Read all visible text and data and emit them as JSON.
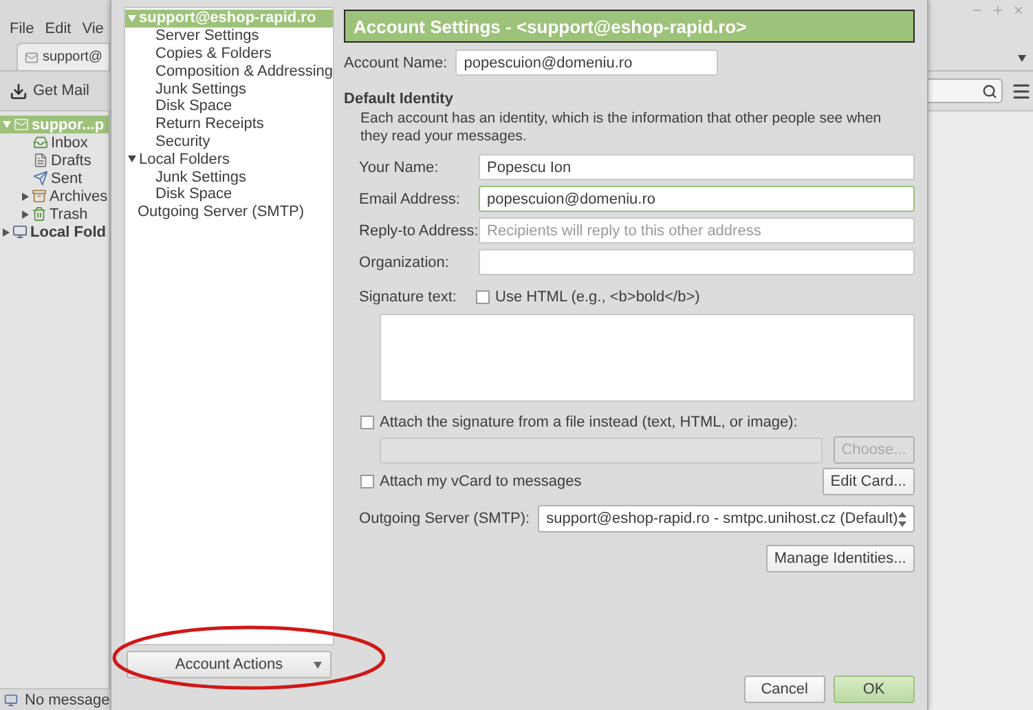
{
  "main_window": {
    "menu": [
      "File",
      "Edit",
      "Vie"
    ],
    "tab": {
      "label": "support@"
    },
    "get_mail": "Get Mail",
    "folders": [
      {
        "label": "suppor...p",
        "kind": "account",
        "selected": true,
        "expanded": true,
        "children": [
          {
            "label": "Inbox",
            "kind": "inbox",
            "selected": false,
            "expanded": false
          },
          {
            "label": "Drafts",
            "kind": "drafts",
            "selected": false,
            "expanded": false
          },
          {
            "label": "Sent",
            "kind": "sent",
            "selected": false,
            "expanded": false
          },
          {
            "label": "Archives",
            "kind": "archive",
            "selected": false,
            "expanded": false,
            "has_children": true
          },
          {
            "label": "Trash",
            "kind": "trash",
            "selected": false,
            "expanded": false,
            "has_children": true
          }
        ]
      },
      {
        "label": "Local Fold",
        "kind": "computer",
        "selected": false,
        "expanded": false,
        "has_children": true
      }
    ],
    "status_bar": "No message"
  },
  "dialog": {
    "tree": [
      {
        "label": "support@eshop-rapid.ro",
        "selected": true,
        "expanded": true,
        "children": [
          {
            "label": "Server Settings",
            "selected": false
          },
          {
            "label": "Copies & Folders",
            "selected": false
          },
          {
            "label": "Composition & Addressing",
            "selected": false
          },
          {
            "label": "Junk Settings",
            "selected": false
          },
          {
            "label": "Disk Space",
            "selected": false
          },
          {
            "label": "Return Receipts",
            "selected": false
          },
          {
            "label": "Security",
            "selected": false
          }
        ]
      },
      {
        "label": "Local Folders",
        "selected": false,
        "expanded": true,
        "children": [
          {
            "label": "Junk Settings",
            "selected": false
          },
          {
            "label": "Disk Space",
            "selected": false
          }
        ]
      },
      {
        "label": "Outgoing Server (SMTP)",
        "selected": false
      }
    ],
    "account_actions": "Account Actions",
    "header": "Account Settings - <support@eshop-rapid.ro>",
    "account_name": {
      "label": "Account Name:",
      "value": "popescuion@domeniu.ro"
    },
    "section_title": "Default Identity",
    "description": "Each account has an identity, which is the information that other people see when they read your messages.",
    "fields": [
      {
        "label": "Your Name:",
        "value": "Popescu Ion",
        "focused": false
      },
      {
        "label": "Email Address:",
        "value": "popescuion@domeniu.ro",
        "focused": true
      },
      {
        "label": "Reply-to Address:",
        "placeholder": "Recipients will reply to this other address",
        "focused": false
      },
      {
        "label": "Organization:",
        "focused": false
      }
    ],
    "signature": {
      "label": "Signature text:",
      "use_html": {
        "label": "Use HTML (e.g., <b>bold</b>)",
        "checked": false
      }
    },
    "attach_file": {
      "label": "Attach the signature from a file instead (text, HTML, or image):",
      "checked": false
    },
    "choose_button": {
      "label": "Choose...",
      "disabled": true
    },
    "attach_vcard": {
      "label": "Attach my vCard to messages",
      "checked": false
    },
    "edit_card": "Edit Card...",
    "outgoing_server": {
      "label": "Outgoing Server (SMTP):",
      "value": "support@eshop-rapid.ro - smtpc.unihost.cz (Default)"
    },
    "manage_identities": "Manage Identities...",
    "buttons": [
      {
        "label": "Cancel",
        "kind": "default"
      },
      {
        "label": "OK",
        "kind": "primary"
      }
    ],
    "annotation": {
      "kind": "ellipse"
    }
  }
}
